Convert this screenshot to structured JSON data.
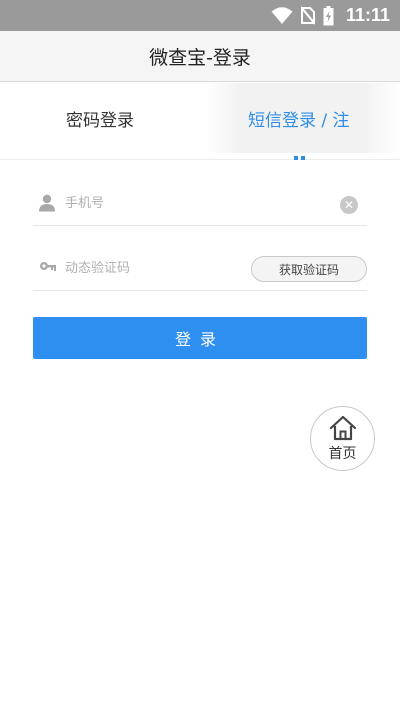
{
  "status_bar": {
    "time": "11:11",
    "icons": [
      "wifi-icon",
      "no-sim-icon",
      "battery-charging-icon"
    ]
  },
  "header": {
    "title": "微查宝-登录"
  },
  "tabs": [
    {
      "label": "密码登录",
      "active": false
    },
    {
      "label": "短信登录 / 注",
      "active": true
    }
  ],
  "form": {
    "phone": {
      "placeholder": "手机号",
      "value": "",
      "icon": "user-icon",
      "clear_icon": "clear-icon"
    },
    "code": {
      "placeholder": "动态验证码",
      "value": "",
      "icon": "key-icon"
    },
    "get_code_label": "获取验证码",
    "login_label": "登录"
  },
  "home_button": {
    "label": "首页",
    "icon": "home-icon"
  },
  "colors": {
    "accent": "#2f8ff0",
    "status_bar": "#9a9a9a",
    "header_bg": "#f5f5f5"
  }
}
